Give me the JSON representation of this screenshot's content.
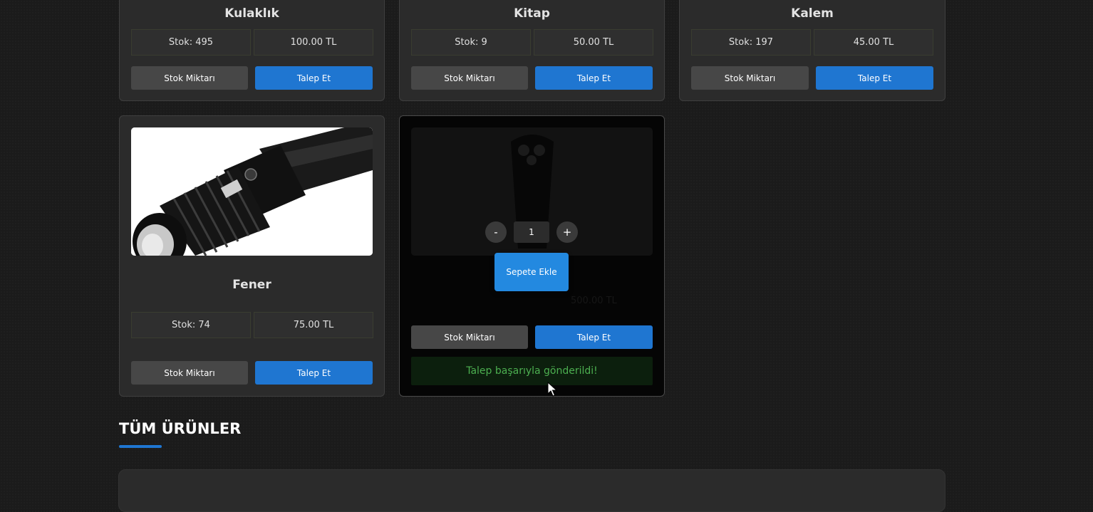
{
  "products_top": [
    {
      "name": "Kulaklık",
      "stock": "Stok: 495",
      "price": "100.00 TL",
      "stock_button": "Stok Miktarı",
      "request_button": "Talep Et"
    },
    {
      "name": "Kitap",
      "stock": "Stok: 9",
      "price": "50.00 TL",
      "stock_button": "Stok Miktarı",
      "request_button": "Talep Et"
    },
    {
      "name": "Kalem",
      "stock": "Stok: 197",
      "price": "45.00 TL",
      "stock_button": "Stok Miktarı",
      "request_button": "Talep Et"
    }
  ],
  "product_fener": {
    "name": "Fener",
    "stock": "Stok: 74",
    "price": "75.00 TL",
    "stock_button": "Stok Miktarı",
    "request_button": "Talep Et",
    "image": "flashlight-image"
  },
  "product_overlay": {
    "image": "trimmer-image",
    "minus_label": "-",
    "plus_label": "+",
    "quantity": "1",
    "add_to_cart": "Sepete Ekle",
    "stock_button": "Stok Miktarı",
    "request_button": "Talep Et",
    "success_message": "Talep başarıyla gönderildi!",
    "faded_price": "500.00 TL"
  },
  "section": {
    "title": "TÜM ÜRÜNLER"
  },
  "colors": {
    "accent": "#1f76d1",
    "success": "#4caf50",
    "card": "#2b2b2b"
  }
}
